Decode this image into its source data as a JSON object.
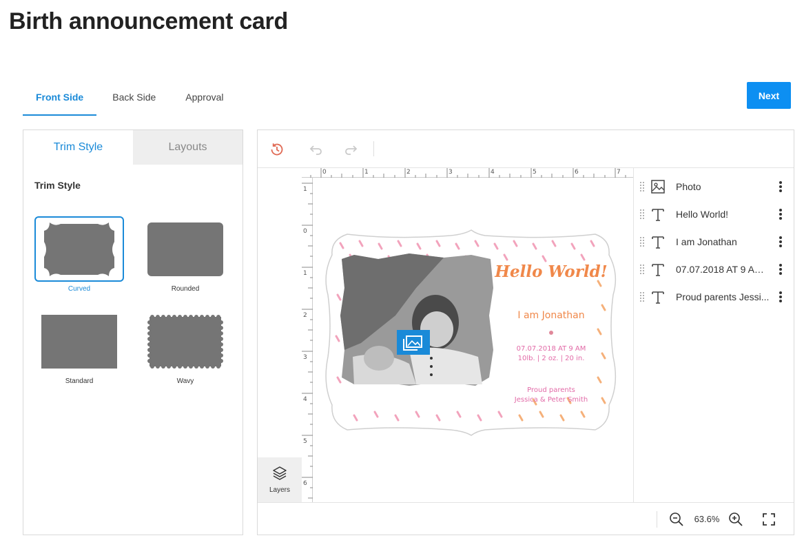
{
  "page": {
    "title": "Birth announcement card"
  },
  "tabs": [
    {
      "label": "Front Side",
      "active": true
    },
    {
      "label": "Back Side",
      "active": false
    },
    {
      "label": "Approval",
      "active": false
    }
  ],
  "next_label": "Next",
  "left_panel": {
    "tabs": [
      {
        "label": "Trim Style",
        "active": true
      },
      {
        "label": "Layouts",
        "active": false
      }
    ],
    "heading": "Trim Style",
    "options": [
      {
        "label": "Curved",
        "selected": true
      },
      {
        "label": "Rounded",
        "selected": false
      },
      {
        "label": "Standard",
        "selected": false
      },
      {
        "label": "Wavy",
        "selected": false
      }
    ]
  },
  "toolbar": {
    "history_icon": "history-icon",
    "undo_icon": "undo-icon",
    "redo_icon": "redo-icon"
  },
  "rulers": {
    "horizontal": [
      "0",
      "1",
      "2",
      "3",
      "4",
      "5",
      "6",
      "7"
    ],
    "vertical": [
      "1",
      "0",
      "1",
      "2",
      "3",
      "4",
      "5",
      "6"
    ]
  },
  "layers_button": {
    "label": "Layers"
  },
  "card": {
    "hello": "Hello World!",
    "name": "I am Jonathan",
    "date": "07.07.2018 AT 9 AM",
    "stats": "10lb. | 2 oz. | 20 in.",
    "parents_line1": "Proud parents",
    "parents_line2": "Jessica & Peter Smith",
    "colors": {
      "accent_orange": "#f0884a",
      "accent_pink": "#e26aa7",
      "dash_pink": "#f2a3bc",
      "dash_orange": "#f5b07a"
    }
  },
  "layers": [
    {
      "type": "photo",
      "label": "Photo"
    },
    {
      "type": "text",
      "label": "Hello World!"
    },
    {
      "type": "text",
      "label": "I am Jonathan"
    },
    {
      "type": "text",
      "label": "07.07.2018 AT 9 AM ..."
    },
    {
      "type": "text",
      "label": "Proud parents Jessi..."
    }
  ],
  "zoom": {
    "value": "63.6%"
  },
  "colors": {
    "accent": "#1a8ad8",
    "button": "#0d8ff2"
  }
}
